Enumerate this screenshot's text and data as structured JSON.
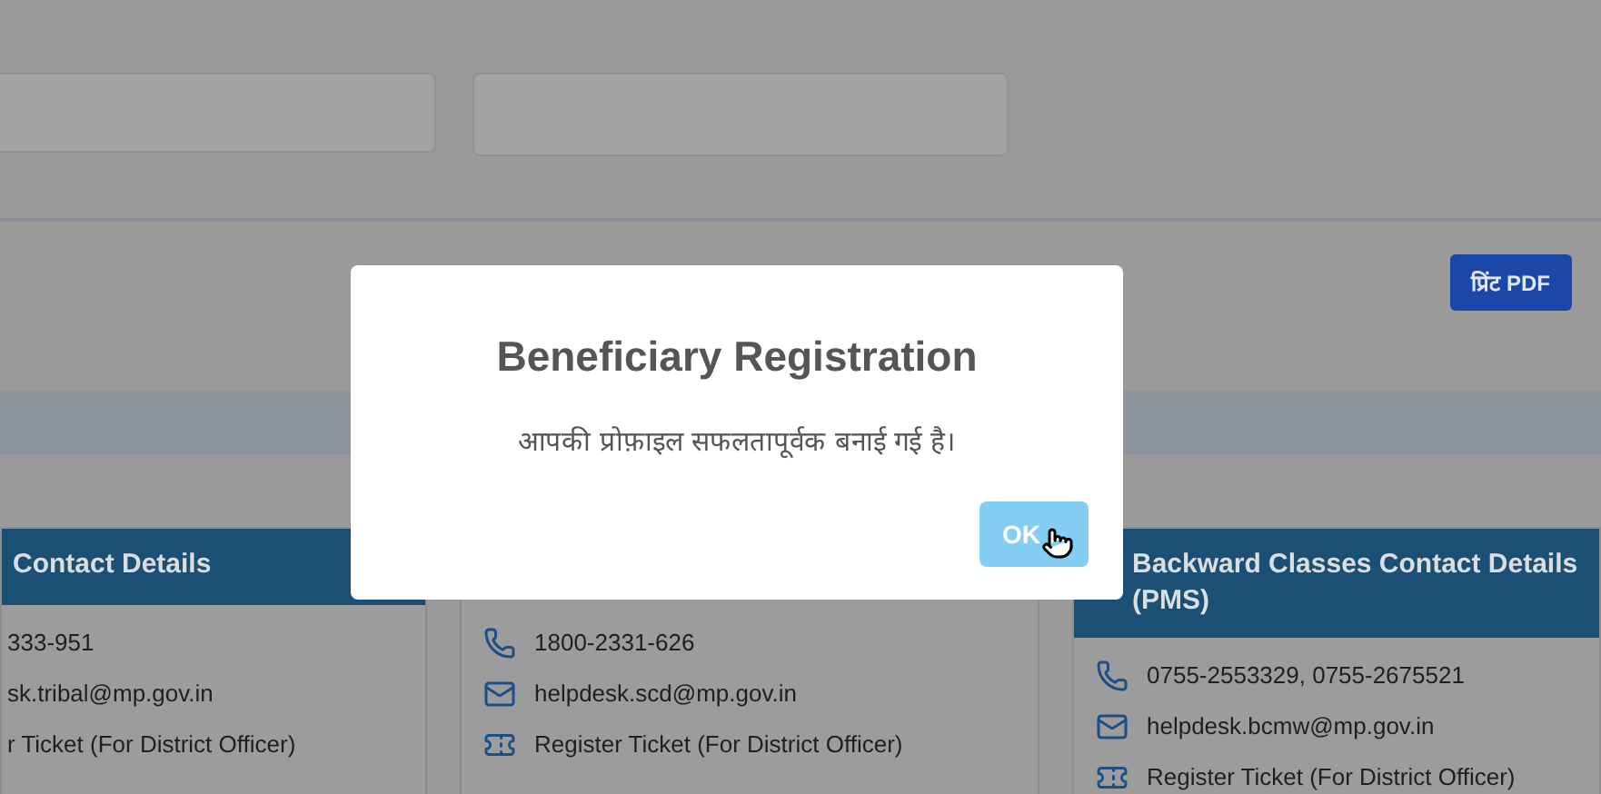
{
  "print_button": "प्रिंट PDF",
  "cards": [
    {
      "title": "Contact Details",
      "items": [
        {
          "kind": "phone",
          "text": "333-951"
        },
        {
          "kind": "email",
          "text": "sk.tribal@mp.gov.in"
        },
        {
          "kind": "ticket",
          "text": "r Ticket (For District Officer)"
        }
      ]
    },
    {
      "items": [
        {
          "kind": "phone",
          "text": "1800-2331-626"
        },
        {
          "kind": "email",
          "text": "helpdesk.scd@mp.gov.in"
        },
        {
          "kind": "ticket",
          "text": "Register Ticket (For District Officer)"
        }
      ]
    },
    {
      "title": "Backward Classes Contact Details (PMS)",
      "items": [
        {
          "kind": "phone",
          "text": "0755-2553329, 0755-2675521"
        },
        {
          "kind": "email",
          "text": "helpdesk.bcmw@mp.gov.in"
        },
        {
          "kind": "ticket",
          "text": "Register Ticket (For District Officer)"
        }
      ]
    }
  ],
  "modal": {
    "title": "Beneficiary Registration",
    "message": "आपकी प्रोफ़ाइल सफलतापूर्वक बनाई गई है।",
    "ok_button": "OK"
  }
}
